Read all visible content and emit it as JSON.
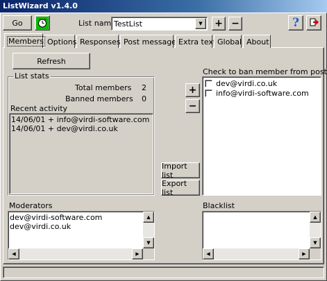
{
  "window": {
    "title": "ListWizard v1.4.0"
  },
  "toolbar": {
    "go_label": "Go",
    "list_name_label": "List name",
    "list_name_value": "TestList",
    "add_symbol": "+",
    "remove_symbol": "−",
    "help_symbol": "?"
  },
  "tabs": [
    {
      "label": "Members"
    },
    {
      "label": "Options"
    },
    {
      "label": "Responses"
    },
    {
      "label": "Post message"
    },
    {
      "label": "Extra text"
    },
    {
      "label": "Global"
    },
    {
      "label": "About"
    }
  ],
  "members": {
    "refresh_label": "Refresh",
    "list_stats": {
      "title": "List stats",
      "total_label": "Total members",
      "total_value": "2",
      "banned_label": "Banned members",
      "banned_value": "0"
    },
    "recent_activity": {
      "label": "Recent activity",
      "items": [
        "14/06/01 + info@virdi-software.com",
        "14/06/01 + dev@virdi.co.uk"
      ]
    },
    "ban": {
      "label": "Check to ban member from posting",
      "items": [
        {
          "email": "dev@virdi.co.uk",
          "checked": false
        },
        {
          "email": "info@virdi-software.com",
          "checked": false
        }
      ]
    },
    "import_label": "Import list",
    "export_label": "Export list",
    "moderators": {
      "label": "Moderators",
      "items": [
        "dev@virdi-software.com",
        "dev@virdi.co.uk"
      ]
    },
    "blacklist": {
      "label": "Blacklist",
      "items": []
    }
  },
  "colors": {
    "titlebar_start": "#0a246a",
    "titlebar_end": "#a6caf0",
    "face": "#d4d0c8",
    "timer_bg": "#00c000",
    "help_icon": "#1a5fd0"
  },
  "icons": {
    "timer": "clock-icon",
    "help": "help-question-icon",
    "exit": "exit-icon"
  }
}
